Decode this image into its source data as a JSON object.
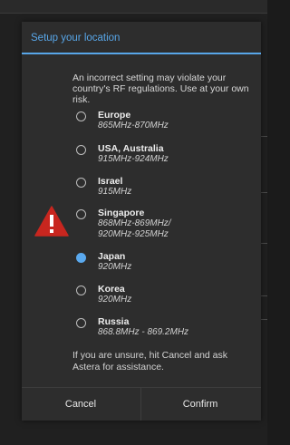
{
  "dialog": {
    "title": "Setup your location",
    "warning": "An incorrect setting may violate your country's RF regulations. Use at your own risk.",
    "alert_icon": "warning-triangle-icon",
    "alert_color": "#c8261f",
    "accent_color": "#58a6e8",
    "options": [
      {
        "name": "Europe",
        "freq": "865MHz-870MHz",
        "selected": false
      },
      {
        "name": "USA, Australia",
        "freq": "915MHz-924MHz",
        "selected": false
      },
      {
        "name": "Israel",
        "freq": "915MHz",
        "selected": false
      },
      {
        "name": "Singapore",
        "freq": "868MHz-869MHz/",
        "freq2": "920MHz-925MHz",
        "selected": false
      },
      {
        "name": "Japan",
        "freq": "920MHz",
        "selected": true
      },
      {
        "name": "Korea",
        "freq": "920MHz",
        "selected": false
      },
      {
        "name": "Russia",
        "freq": "868.8MHz - 869.2MHz",
        "selected": false
      }
    ],
    "footer": "If you are unsure, hit Cancel and ask Astera for assistance.",
    "cancel_label": "Cancel",
    "confirm_label": "Confirm"
  }
}
